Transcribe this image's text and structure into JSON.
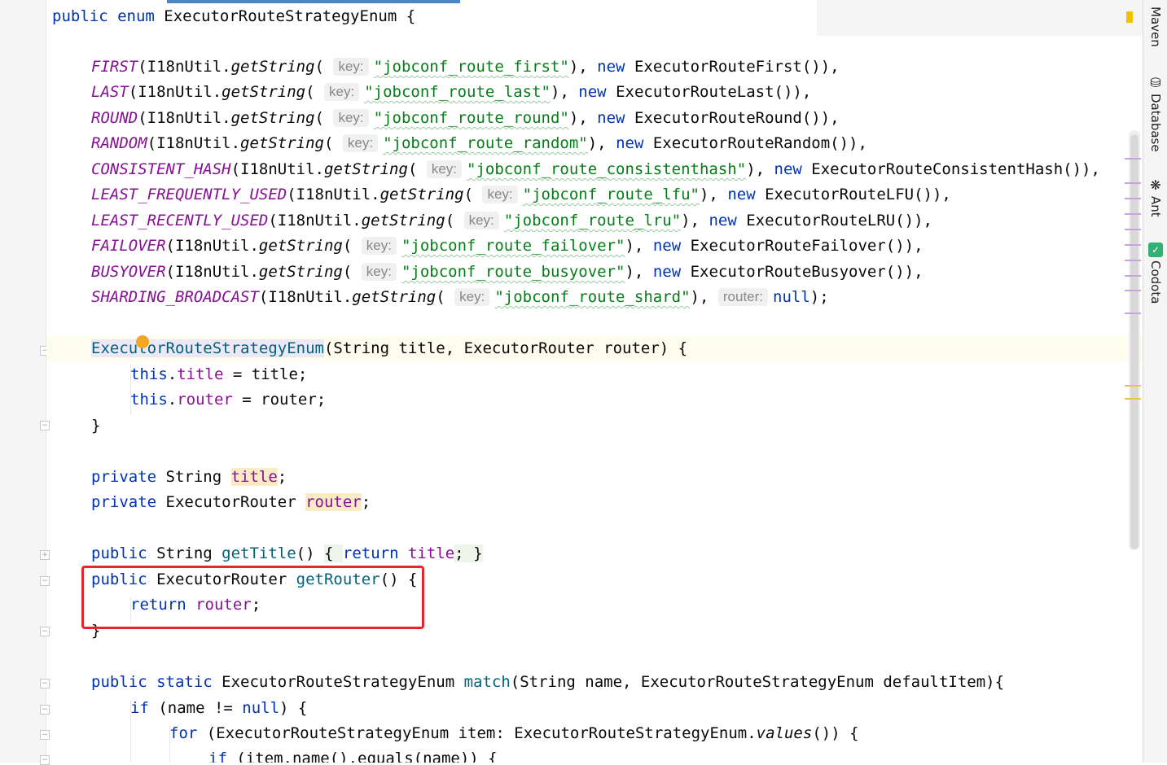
{
  "colors": {
    "keyword": "#0033b3",
    "enum_constant": "#871094",
    "string": "#067d17",
    "method": "#00627a",
    "field": "#871094",
    "red_box": "#e8262a",
    "breakpoint": "#f5a623"
  },
  "code": {
    "line1": {
      "kw": "public enum ",
      "name": "ExecutorRouteStrategyEnum",
      "rest": " {"
    },
    "enums": [
      {
        "name": "FIRST",
        "call": "(I18nUtil.",
        "method": "getString",
        "hint": "key:",
        "str": "\"jobconf_route_first\"",
        "tail_kw": "new",
        "tail": " ExecutorRouteFirst()),",
        "hint2": "",
        "tail2": ""
      },
      {
        "name": "LAST",
        "call": "(I18nUtil.",
        "method": "getString",
        "hint": "key:",
        "str": "\"jobconf_route_last\"",
        "tail_kw": "new",
        "tail": " ExecutorRouteLast()),",
        "hint2": "",
        "tail2": ""
      },
      {
        "name": "ROUND",
        "call": "(I18nUtil.",
        "method": "getString",
        "hint": "key:",
        "str": "\"jobconf_route_round\"",
        "tail_kw": "new",
        "tail": " ExecutorRouteRound()),",
        "hint2": "",
        "tail2": ""
      },
      {
        "name": "RANDOM",
        "call": "(I18nUtil.",
        "method": "getString",
        "hint": "key:",
        "str": "\"jobconf_route_random\"",
        "tail_kw": "new",
        "tail": " ExecutorRouteRandom()),",
        "hint2": "",
        "tail2": ""
      },
      {
        "name": "CONSISTENT_HASH",
        "call": "(I18nUtil.",
        "method": "getString",
        "hint": "key:",
        "str": "\"jobconf_route_consistenthash\"",
        "tail_kw": "new",
        "tail": " ExecutorRouteConsistentHash()),",
        "hint2": "",
        "tail2": ""
      },
      {
        "name": "LEAST_FREQUENTLY_USED",
        "call": "(I18nUtil.",
        "method": "getString",
        "hint": "key:",
        "str": "\"jobconf_route_lfu\"",
        "tail_kw": "new",
        "tail": " ExecutorRouteLFU()),",
        "hint2": "",
        "tail2": ""
      },
      {
        "name": "LEAST_RECENTLY_USED",
        "call": "(I18nUtil.",
        "method": "getString",
        "hint": "key:",
        "str": "\"jobconf_route_lru\"",
        "tail_kw": "new",
        "tail": " ExecutorRouteLRU()),",
        "hint2": "",
        "tail2": ""
      },
      {
        "name": "FAILOVER",
        "call": "(I18nUtil.",
        "method": "getString",
        "hint": "key:",
        "str": "\"jobconf_route_failover\"",
        "tail_kw": "new",
        "tail": " ExecutorRouteFailover()),",
        "hint2": "",
        "tail2": ""
      },
      {
        "name": "BUSYOVER",
        "call": "(I18nUtil.",
        "method": "getString",
        "hint": "key:",
        "str": "\"jobconf_route_busyover\"",
        "tail_kw": "new",
        "tail": " ExecutorRouteBusyover()),",
        "hint2": "",
        "tail2": ""
      },
      {
        "name": "SHARDING_BROADCAST",
        "call": "(I18nUtil.",
        "method": "getString",
        "hint": "key:",
        "str": "\"jobconf_route_shard\"",
        "tail_kw": "",
        "tail": "",
        "hint2": "router:",
        "tail2": "null"
      }
    ],
    "ctor": {
      "name": "ExecutorRouteStrategyEnum",
      "params": "(String title, ExecutorRouter router) {"
    },
    "assign_title": {
      "kw": "this",
      "dot": ".",
      "field": "title",
      "rest": " = title;"
    },
    "assign_router": {
      "kw": "this",
      "dot": ".",
      "field": "router",
      "rest": " = router;"
    },
    "close_brace": "}",
    "field_title": {
      "kw": "private",
      "type": " String ",
      "name": "title",
      "semi": ";"
    },
    "field_router": {
      "kw": "private",
      "type": " ExecutorRouter ",
      "name": "router",
      "semi": ";"
    },
    "get_title": {
      "kw": "public",
      "type": " String ",
      "name": "getTitle",
      "paren": "() ",
      "open": "{ ",
      "ret": "return",
      "field": " title",
      "semi": "; ",
      "close": "}"
    },
    "get_router": {
      "kw": "public",
      "type": " ExecutorRouter ",
      "name": "getRouter",
      "rest": "() {"
    },
    "return_router": {
      "kw": "return",
      "field": " router",
      "semi": ";"
    },
    "close_brace2": "}",
    "match_decl": {
      "kw1": "public",
      "kw2": " static",
      "type": " ExecutorRouteStrategyEnum ",
      "name": "match",
      "rest": "(String name, ExecutorRouteStrategyEnum defaultItem){"
    },
    "if_line": {
      "kw": "if",
      "rest1": " (name != ",
      "null_kw": "null",
      "rest2": ") {"
    },
    "for_line": {
      "kw": "for",
      "rest1": " (ExecutorRouteStrategyEnum item: ExecutorRouteStrategyEnum.",
      "method": "values",
      "rest2": "()) {"
    },
    "inner_if": {
      "kw": "if",
      "rest": " (item.name().equals(name)) {"
    }
  },
  "tools": {
    "maven": "Maven",
    "database": "Database",
    "ant": "Ant",
    "codota": "Codota"
  },
  "icons": {
    "database": "database-icon",
    "ant": "ant-icon",
    "codota": "codota-icon"
  }
}
